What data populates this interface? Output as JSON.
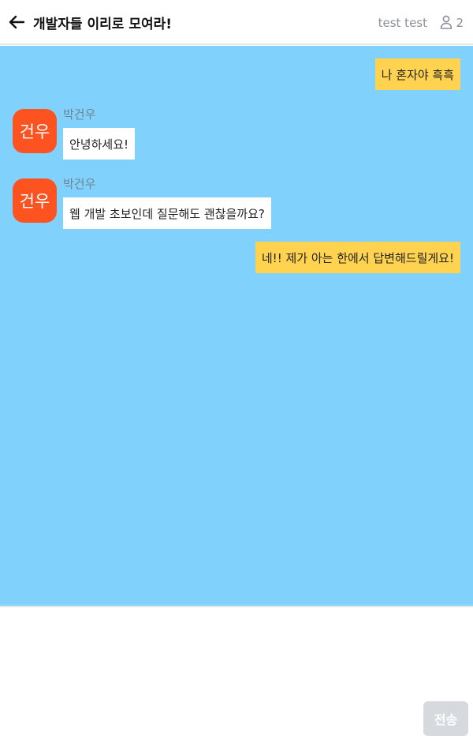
{
  "header": {
    "title": "개발자들 이리로 모여라!",
    "user_name": "test test",
    "member_count": "2",
    "back_icon": "arrow-left-icon",
    "member_icon": "person-icon"
  },
  "messages": [
    {
      "type": "mine",
      "text": "나 혼자야 흑흑"
    },
    {
      "type": "theirs",
      "sender": "박건우",
      "avatar_text": "건우",
      "text": "안녕하세요!"
    },
    {
      "type": "theirs",
      "sender": "박건우",
      "avatar_text": "건우",
      "text": "웹 개발 초보인데 질문해도 괜찮을까요?"
    },
    {
      "type": "mine",
      "text": "네!! 제가 아는 한에서 답변해드릴게요!"
    }
  ],
  "composer": {
    "value": "",
    "send_label": "전송"
  },
  "colors": {
    "chat_background": "#80d2fc",
    "my_bubble": "#ffd24f",
    "their_bubble": "#ffffff",
    "avatar": "#fd5321",
    "send_button_disabled": "#d6d9de"
  }
}
